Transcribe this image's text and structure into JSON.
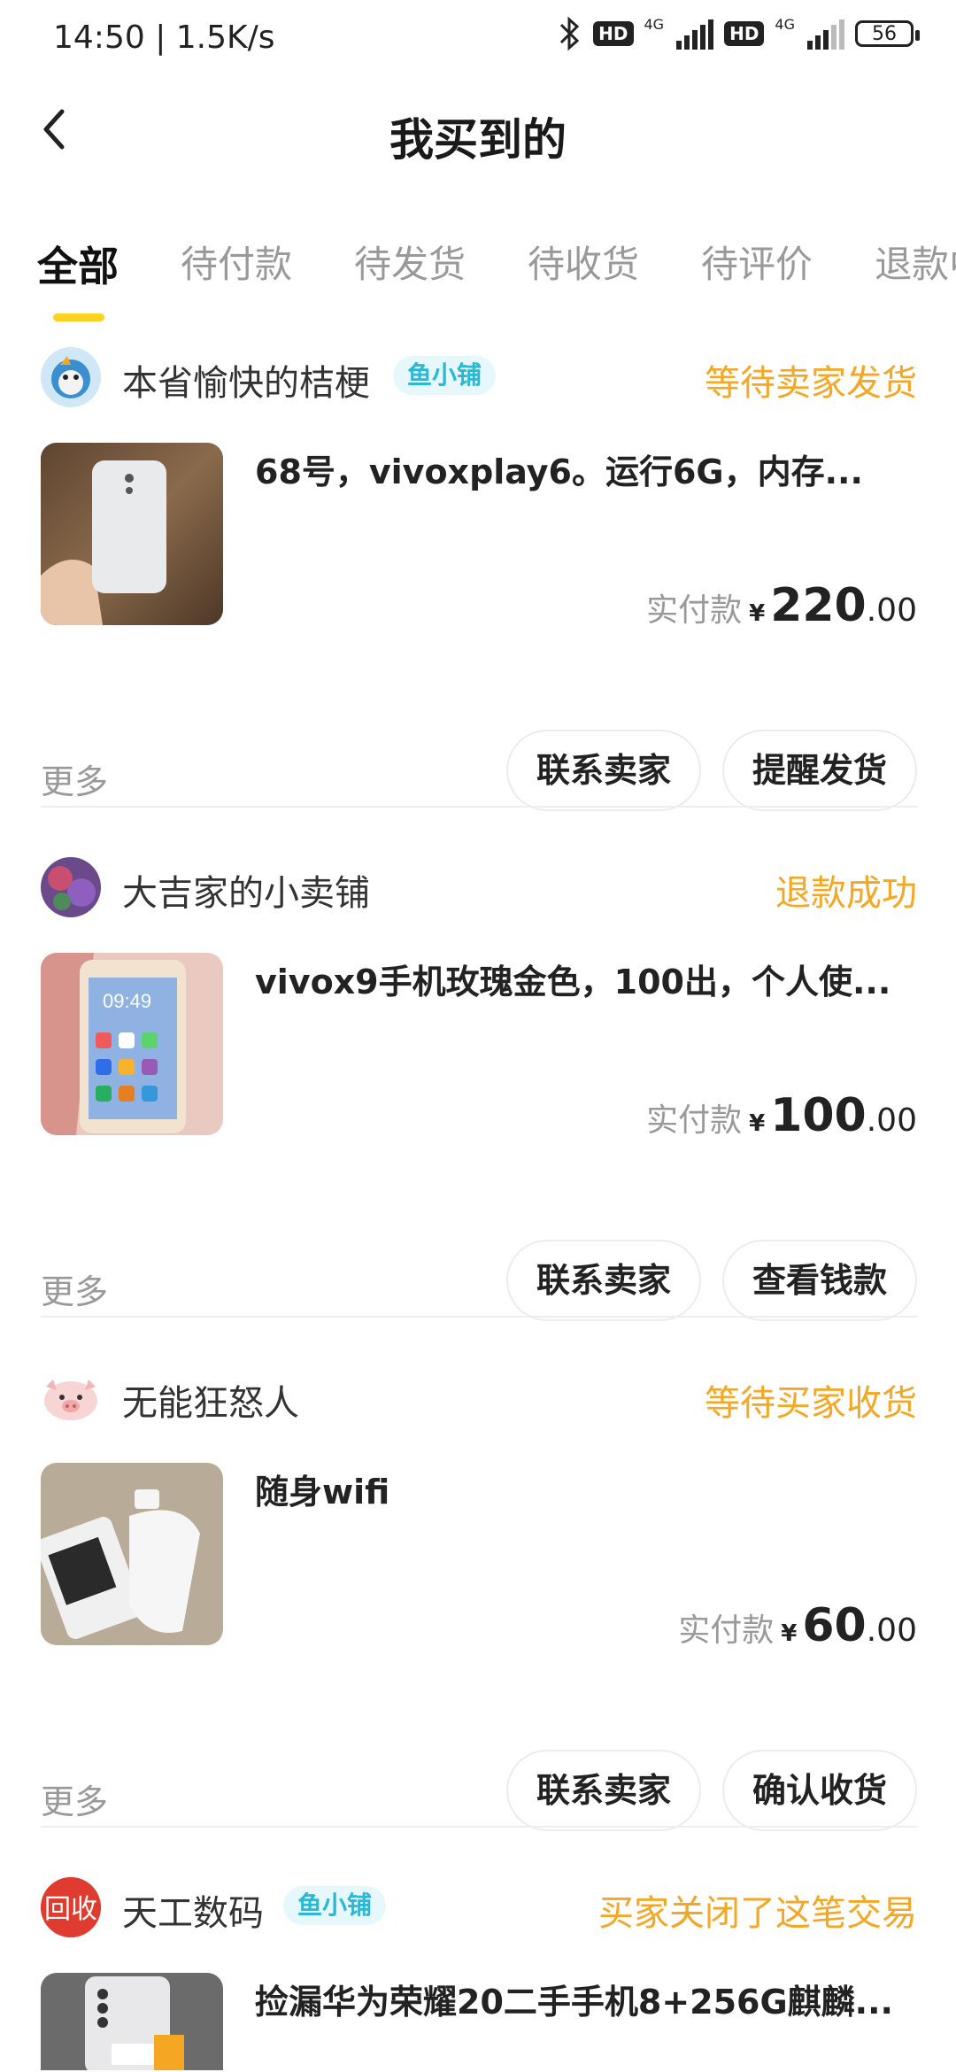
{
  "status_bar": {
    "time": "14:50 | 1.5K/s",
    "hd1": "HD",
    "net1": "4G",
    "hd2": "HD",
    "net2": "4G",
    "battery": "56"
  },
  "header": {
    "title": "我买到的"
  },
  "tabs": [
    {
      "label": "全部"
    },
    {
      "label": "待付款"
    },
    {
      "label": "待发货"
    },
    {
      "label": "待收货"
    },
    {
      "label": "待评价"
    },
    {
      "label": "退款中"
    }
  ],
  "orders": [
    {
      "shop": "本省愉快的桔梗",
      "tag": "鱼小铺",
      "status": "等待卖家发货",
      "title": "68号，vivoxplay6。运行6G，内存...",
      "price_label": "实付款",
      "currency": "¥",
      "price_int": "220",
      "price_dec": ".00",
      "more": "更多",
      "btn1": "联系卖家",
      "btn2": "提醒发货",
      "status_color": "#f5a623"
    },
    {
      "shop": "大吉家的小卖铺",
      "status": "退款成功",
      "title": "vivox9手机玫瑰金色，100出，个人使...",
      "price_label": "实付款",
      "currency": "¥",
      "price_int": "100",
      "price_dec": ".00",
      "more": "更多",
      "btn1": "联系卖家",
      "btn2": "查看钱款",
      "status_color": "#f5a623"
    },
    {
      "shop": "无能狂怒人",
      "status": "等待买家收货",
      "title": "随身wifi",
      "price_label": "实付款",
      "currency": "¥",
      "price_int": "60",
      "price_dec": ".00",
      "more": "更多",
      "btn1": "联系卖家",
      "btn2": "确认收货",
      "status_color": "#f5a623"
    },
    {
      "shop": "天工数码",
      "tag": "鱼小铺",
      "status": "买家关闭了这笔交易",
      "title": "捡漏华为荣耀20二手手机8+256G麒麟...",
      "status_color": "#f5a623",
      "avatar_text": "回收"
    }
  ]
}
